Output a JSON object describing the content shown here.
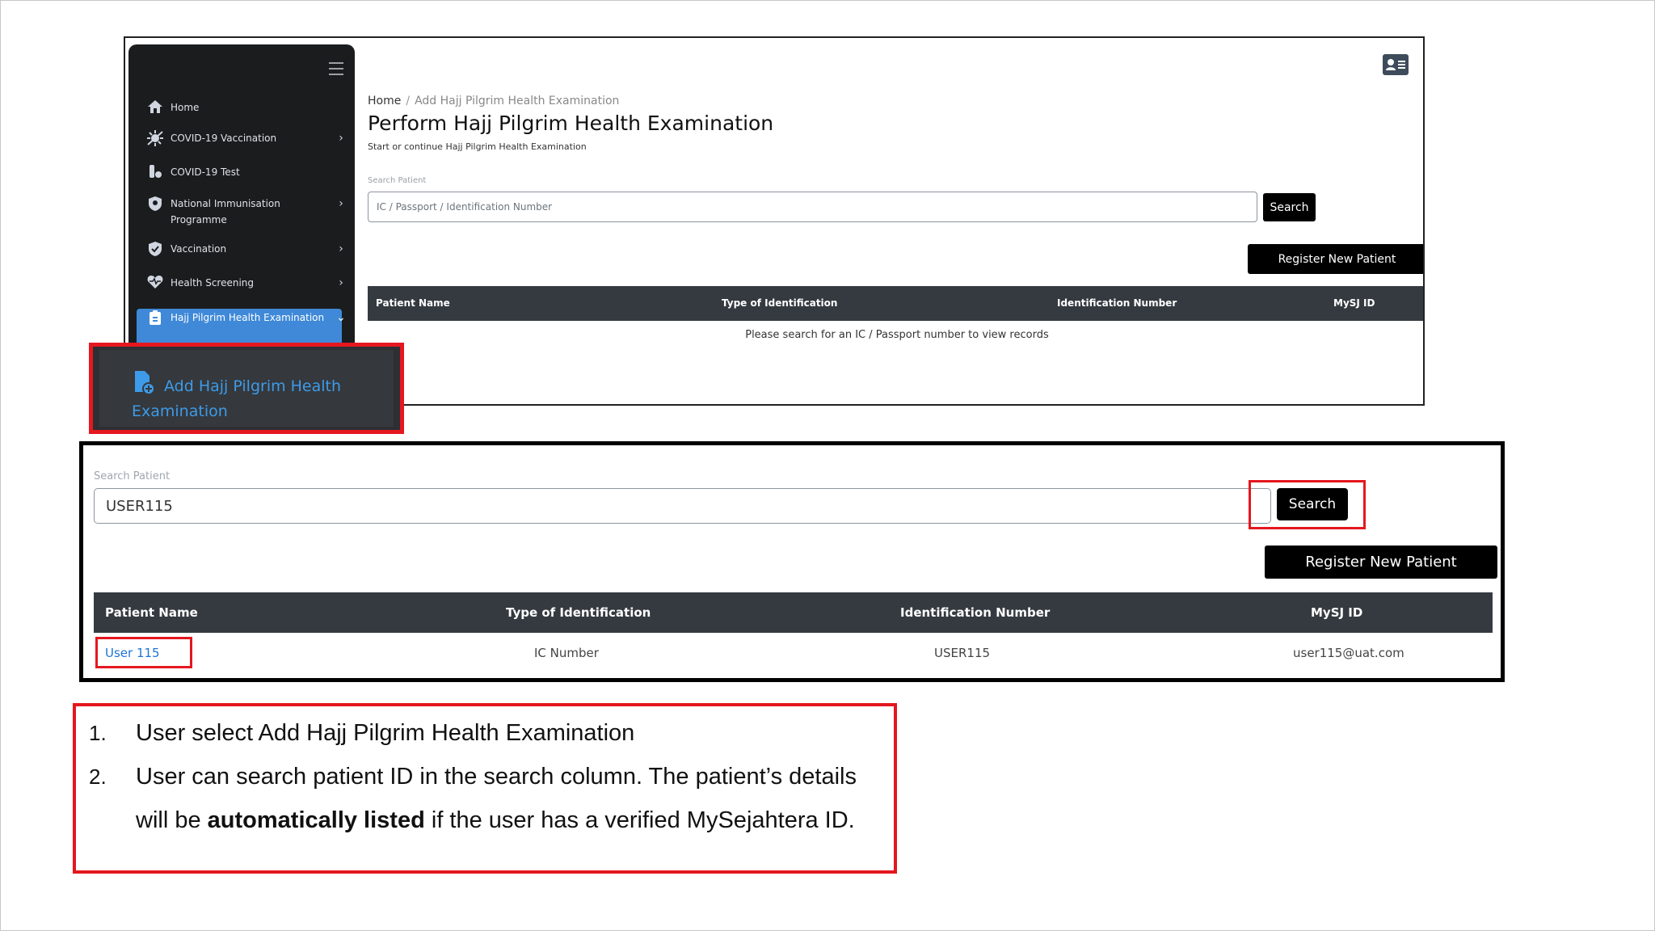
{
  "sidebar": {
    "items": [
      {
        "label": "Home",
        "icon": "home-icon",
        "chevron": ""
      },
      {
        "label": "COVID-19 Vaccination",
        "icon": "virus-icon",
        "chevron": "›"
      },
      {
        "label": "COVID-19 Test",
        "icon": "test-tube-icon",
        "chevron": ""
      },
      {
        "label": "National Immunisation Programme",
        "icon": "shield-icon",
        "chevron": "›"
      },
      {
        "label": "Vaccination",
        "icon": "shield-check-icon",
        "chevron": "›"
      },
      {
        "label": "Health Screening",
        "icon": "heart-pulse-icon",
        "chevron": "›"
      },
      {
        "label": "Hajj Pilgrim Health Examination",
        "icon": "clipboard-icon",
        "chevron": "⌄"
      }
    ],
    "active_color": "#3f89d8"
  },
  "callout": {
    "label": "Add Hajj Pilgrim Health Examination",
    "text_color": "#3d9be9"
  },
  "header": {
    "breadcrumb_home": "Home",
    "breadcrumb_separator": "/",
    "breadcrumb_current": "Add Hajj Pilgrim Health Examination",
    "title": "Perform Hajj Pilgrim Health Examination",
    "subtitle": "Start or continue Hajj Pilgrim Health Examination"
  },
  "search": {
    "label": "Search Patient",
    "placeholder": "IC / Passport / Identification Number",
    "value": "USER115",
    "button": "Search"
  },
  "register_button": "Register New Patient",
  "table": {
    "headers": [
      "Patient Name",
      "Type of Identification",
      "Identification Number",
      "MySJ ID"
    ],
    "empty_message": "Please search for an IC / Passport number to view records",
    "rows": [
      {
        "name": "User 115",
        "id_type": "IC Number",
        "id_number": "USER115",
        "mysj_id": "user115@uat.com"
      }
    ]
  },
  "instructions": {
    "step1_number": "1.",
    "step1_text": "User select Add Hajj Pilgrim Health Examination",
    "step2_number": "2.",
    "step2_text_a": "User can search patient ID in the search column. The patient’s details",
    "step2_text_b_prefix": "will be ",
    "step2_text_b_bold": "automatically listed",
    "step2_text_b_suffix": " if the user has a verified MySejahtera ID."
  },
  "colors": {
    "highlight_red": "#e5171f",
    "table_header": "#343a40",
    "link_blue": "#1f73d8"
  }
}
